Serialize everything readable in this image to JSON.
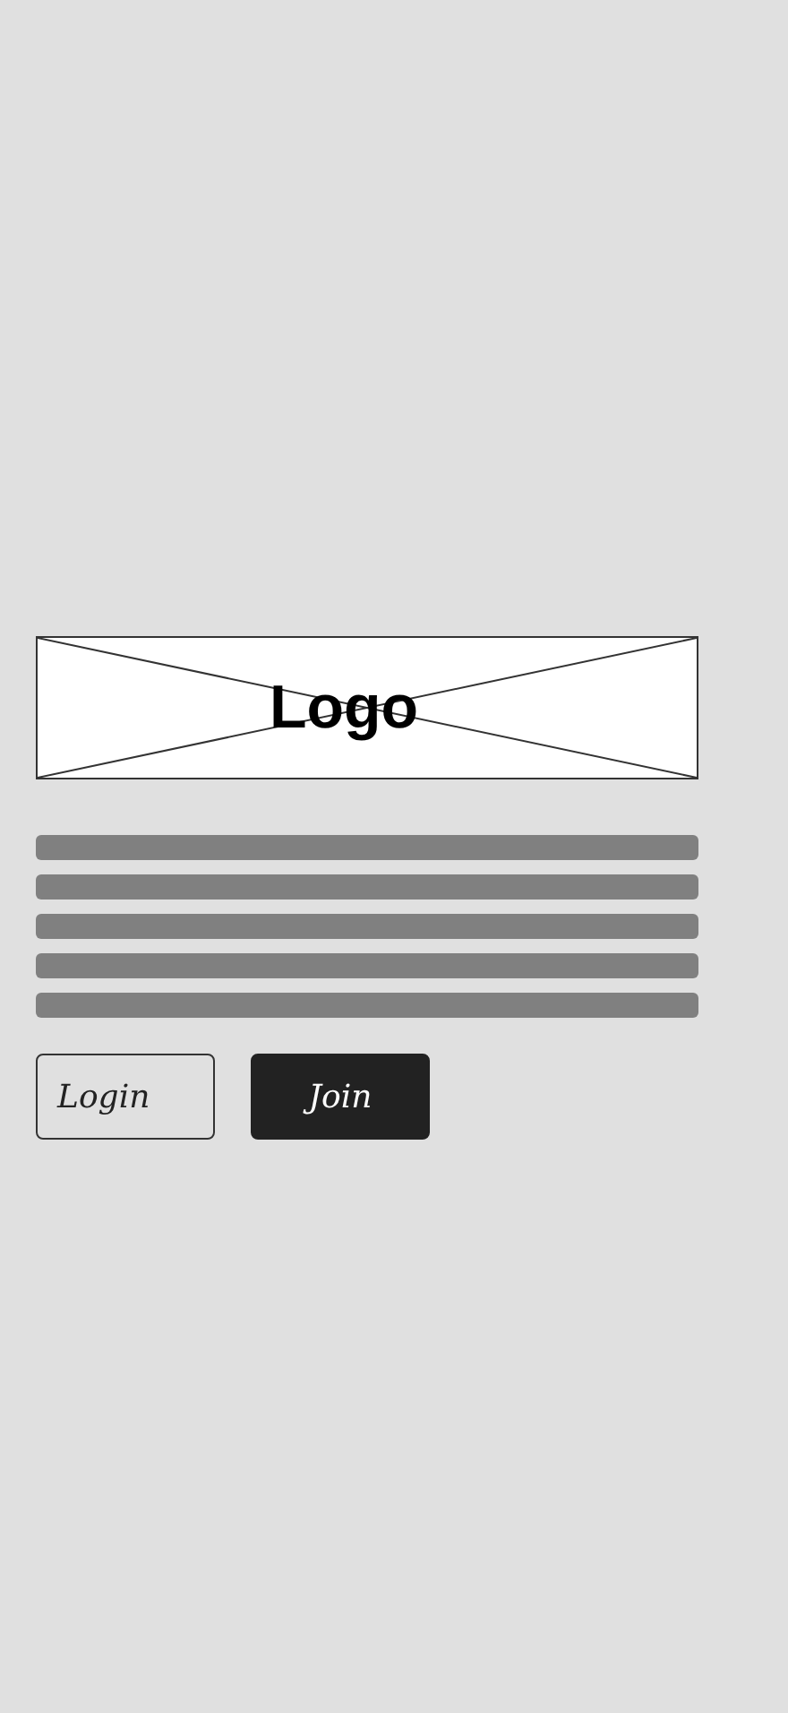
{
  "logo": {
    "label": "Logo"
  },
  "buttons": [
    {
      "label": "Login",
      "kind": "outline"
    },
    {
      "label": "Join",
      "kind": "filled"
    }
  ]
}
